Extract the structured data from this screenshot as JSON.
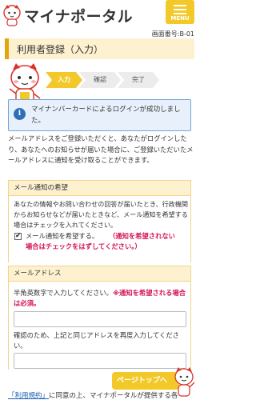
{
  "header": {
    "logo_text": "マイナポータル",
    "menu_label": "MENU"
  },
  "screen_number": "画面番号:B-01",
  "page_title": "利用者登録（入力）",
  "steps": [
    {
      "label": "入力",
      "active": true
    },
    {
      "label": "確認",
      "active": false
    },
    {
      "label": "完了",
      "active": false
    }
  ],
  "info_message": "マイナンバーカードによるログインが成功しました。",
  "intro_text": "メールアドレスをご登録いただくと、あなたがログインしたり、あなたへのお知らせが届いた場合に、ご登録いただいたメールアドレスに通知を受け取ることができます。",
  "notification_section": {
    "heading": "メール通知の希望",
    "description": "あなたの情報やお問い合わせの回答が届いたとき、行政機関からお知らせなどが届いたときなど、メール通知を希望する場合はチェックを入れてください。",
    "checkbox_label": "メール通知を希望する。",
    "checkbox_checked": true,
    "note_line1": "（通知を希望されない",
    "note_line2": "場合はチェックをはずしてください。）"
  },
  "email_section": {
    "heading": "メールアドレス",
    "label_prefix": "半角英数字で入力してください。",
    "label_required": "※通知を希望される場合は必須。",
    "confirm_label": "確認のため、上記と同じアドレスを再度入力してください。",
    "email_value": "",
    "confirm_value": ""
  },
  "page_top_button": "ページトップへ",
  "bottom": {
    "link_text": "「利用規約」",
    "rest_text": "に同意の上、マイナポータルが提供する各"
  },
  "colors": {
    "accent_yellow": "#f3c92a",
    "title_bg": "#fdf1cf",
    "info_blue": "#2f6fb7",
    "alert_red": "#d4145a"
  }
}
